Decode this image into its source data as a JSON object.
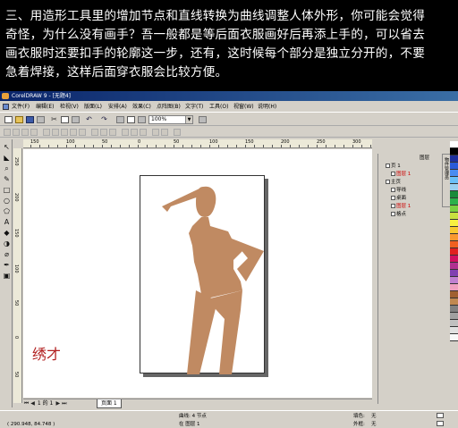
{
  "banner": {
    "lines": [
      "三、用造形工具里的增加节点和直线转换为曲线调整人体外形，你可能会觉得",
      "奇怪，为什么没有画手？吾一般都是等后面衣服画好后再添上手的，可以省去",
      "画衣服时还要扣手的轮廓这一步，还有，这时候每个部分是独立分开的，不要",
      "急着焊接，这样后面穿衣服会比较方便。"
    ]
  },
  "app": {
    "title": "CorelDRAW 9 - [无题4]",
    "menu": [
      "文件(F)",
      "编辑(E)",
      "检视(V)",
      "版面(L)",
      "安排(A)",
      "效果(C)",
      "点阵图(B)",
      "文字(T)",
      "工具(O)",
      "视窗(W)",
      "说明(H)"
    ],
    "zoom": "100%",
    "ruler_top_labels": [
      "150",
      "100",
      "50",
      "0",
      "50",
      "100",
      "150",
      "200",
      "250",
      "300"
    ],
    "ruler_left_labels": [
      "250",
      "200",
      "150",
      "100",
      "50",
      "0",
      "50"
    ],
    "page_nav": {
      "current": "1 的 1",
      "tab": "页面 1"
    },
    "status": {
      "coords": "( 290.948, 84.748 )",
      "curve": "曲线: 4 节点",
      "layer": "在 图层 1",
      "fill_label": "填色:",
      "fill_value": "无",
      "outline_label": "外框:",
      "outline_value": "无"
    },
    "docker": {
      "header": "图层",
      "header2": "图层",
      "rows": [
        {
          "label": "页 1",
          "red": false
        },
        {
          "label": "图层 1",
          "red": true
        },
        {
          "label": "主页",
          "red": false
        },
        {
          "label": "导线",
          "red": false
        },
        {
          "label": "桌面",
          "red": false
        },
        {
          "label": "图层 1",
          "red": true
        },
        {
          "label": "格点",
          "red": false
        }
      ],
      "tabs": "物件管理员"
    },
    "signature": "绣才",
    "palette": [
      "#ffffff",
      "#000000",
      "#1e2f9c",
      "#2a5ad8",
      "#4a8cf0",
      "#6ac0f8",
      "#9ad0f0",
      "#1a8a3a",
      "#2ab04a",
      "#7ad040",
      "#c8e040",
      "#f8f040",
      "#f8c830",
      "#f89830",
      "#f06020",
      "#e02020",
      "#d01060",
      "#b03090",
      "#8040b0",
      "#c080d0",
      "#f0a0c0",
      "#a06030",
      "#c08850",
      "#808080",
      "#a0a0a0",
      "#c0c0c0",
      "#e0e0e0",
      "#f8f8f8"
    ],
    "figure_color": "#c08a62"
  }
}
